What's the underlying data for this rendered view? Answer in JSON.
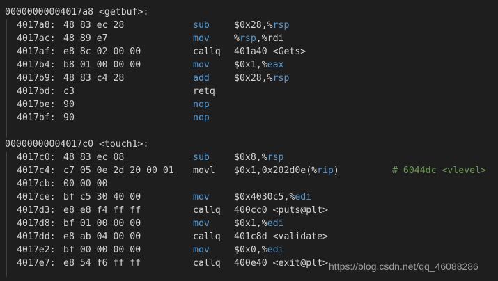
{
  "sections": [
    {
      "header": "00000000004017a8 <getbuf>:",
      "rows": [
        {
          "addr": "4017a8:",
          "bytes": "48 83 ec 28",
          "mnem": "sub",
          "mnem_color": "blue",
          "ops_plain_before": "$0x28,%",
          "ops_reg": "rsp",
          "ops_plain_after": ""
        },
        {
          "addr": "4017ac:",
          "bytes": "48 89 e7",
          "mnem": "mov",
          "mnem_color": "blue",
          "ops_plain_before": "%",
          "ops_reg": "rsp",
          "ops_plain_after": ",%rdi"
        },
        {
          "addr": "4017af:",
          "bytes": "e8 8c 02 00 00",
          "mnem": "callq",
          "mnem_color": "plain",
          "ops_plain_before": "401a40 <Gets>",
          "ops_reg": "",
          "ops_plain_after": ""
        },
        {
          "addr": "4017b4:",
          "bytes": "b8 01 00 00 00",
          "mnem": "mov",
          "mnem_color": "blue",
          "ops_plain_before": "$0x1,%",
          "ops_reg": "eax",
          "ops_plain_after": ""
        },
        {
          "addr": "4017b9:",
          "bytes": "48 83 c4 28",
          "mnem": "add",
          "mnem_color": "blue",
          "ops_plain_before": "$0x28,%",
          "ops_reg": "rsp",
          "ops_plain_after": ""
        },
        {
          "addr": "4017bd:",
          "bytes": "c3",
          "mnem": "retq",
          "mnem_color": "plain",
          "ops_plain_before": "",
          "ops_reg": "",
          "ops_plain_after": ""
        },
        {
          "addr": "4017be:",
          "bytes": "90",
          "mnem": "nop",
          "mnem_color": "blue",
          "ops_plain_before": "",
          "ops_reg": "",
          "ops_plain_after": ""
        },
        {
          "addr": "4017bf:",
          "bytes": "90",
          "mnem": "nop",
          "mnem_color": "blue",
          "ops_plain_before": "",
          "ops_reg": "",
          "ops_plain_after": ""
        }
      ]
    },
    {
      "header": "00000000004017c0 <touch1>:",
      "rows": [
        {
          "addr": "4017c0:",
          "bytes": "48 83 ec 08",
          "mnem": "sub",
          "mnem_color": "blue",
          "ops_plain_before": "$0x8,%",
          "ops_reg": "rsp",
          "ops_plain_after": ""
        },
        {
          "addr": "4017c4:",
          "bytes": "c7 05 0e 2d 20 00 01",
          "mnem": "movl",
          "mnem_color": "plain",
          "ops_plain_before": "$0x1,0x202d0e(%",
          "ops_reg": "rip",
          "ops_plain_after": ")",
          "comment": "# 6044dc <vlevel>"
        },
        {
          "addr": "4017cb:",
          "bytes": "00 00 00",
          "mnem": "",
          "mnem_color": "plain",
          "ops_plain_before": "",
          "ops_reg": "",
          "ops_plain_after": ""
        },
        {
          "addr": "4017ce:",
          "bytes": "bf c5 30 40 00",
          "mnem": "mov",
          "mnem_color": "blue",
          "ops_plain_before": "$0x4030c5,%",
          "ops_reg": "edi",
          "ops_plain_after": ""
        },
        {
          "addr": "4017d3:",
          "bytes": "e8 e8 f4 ff ff",
          "mnem": "callq",
          "mnem_color": "plain",
          "ops_plain_before": "400cc0 <puts@plt>",
          "ops_reg": "",
          "ops_plain_after": ""
        },
        {
          "addr": "4017d8:",
          "bytes": "bf 01 00 00 00",
          "mnem": "mov",
          "mnem_color": "blue",
          "ops_plain_before": "$0x1,%",
          "ops_reg": "edi",
          "ops_plain_after": ""
        },
        {
          "addr": "4017dd:",
          "bytes": "e8 ab 04 00 00",
          "mnem": "callq",
          "mnem_color": "plain",
          "ops_plain_before": "401c8d <validate>",
          "ops_reg": "",
          "ops_plain_after": ""
        },
        {
          "addr": "4017e2:",
          "bytes": "bf 00 00 00 00",
          "mnem": "mov",
          "mnem_color": "blue",
          "ops_plain_before": "$0x0,%",
          "ops_reg": "edi",
          "ops_plain_after": ""
        },
        {
          "addr": "4017e7:",
          "bytes": "e8 54 f6 ff ff",
          "mnem": "callq",
          "mnem_color": "plain",
          "ops_plain_before": "400e40 <exit@plt>",
          "ops_reg": "",
          "ops_plain_after": ""
        }
      ]
    }
  ],
  "watermark": "https://blog.csdn.net/qq_46088286",
  "colors": {
    "background": "#1e1e1e",
    "text": "#d4d4d4",
    "keyword_blue": "#569cd6",
    "comment_green": "#6a9955",
    "indent_guide": "#404040"
  }
}
